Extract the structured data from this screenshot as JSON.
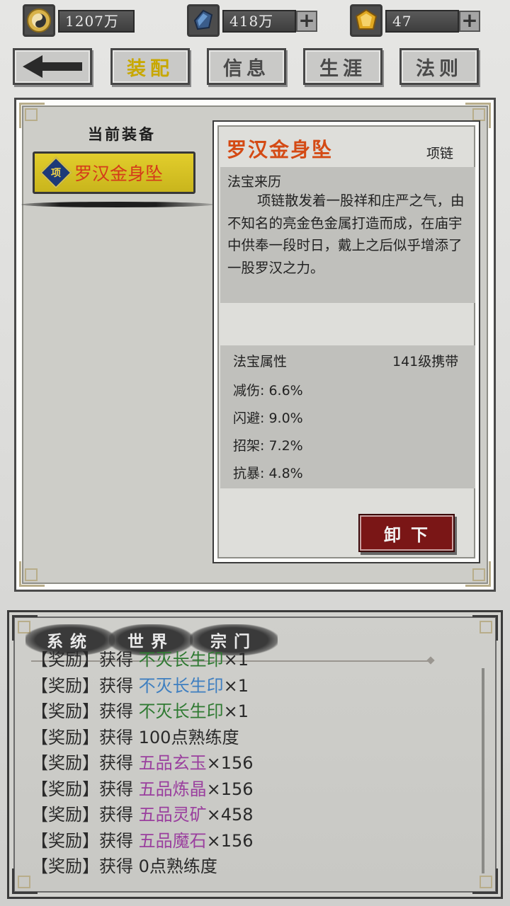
{
  "colors": {
    "accent_gold": "#c8a800",
    "title_red": "#d44a14",
    "equip_slot_yellow": "#e2cd2c",
    "unequip_button": "#7a1616",
    "item_blue": "#3f7fc0",
    "item_green": "#2f7a32",
    "item_purple": "#9a3f9e"
  },
  "resources": [
    {
      "icon": "yin-yang-coin-icon",
      "value": "1207万",
      "has_plus": false
    },
    {
      "icon": "blue-crystal-icon",
      "value": "418万",
      "has_plus": true
    },
    {
      "icon": "gold-gem-icon",
      "value": "47",
      "has_plus": true
    }
  ],
  "back_button": {
    "icon": "back-arrow-icon"
  },
  "tabs": [
    {
      "label": "装配",
      "active": true
    },
    {
      "label": "信息",
      "active": false
    },
    {
      "label": "生涯",
      "active": false
    },
    {
      "label": "法则",
      "active": false
    }
  ],
  "equipment": {
    "section_title": "当前装备",
    "slot_badge": "项",
    "slot_item": "罗汉金身坠"
  },
  "detail": {
    "item_name": "罗汉金身坠",
    "item_type": "项链",
    "lore_label": "法宝来历",
    "lore_text": "项链散发着一股祥和庄严之气，由不知名的亮金色金属打造而成，在庙宇中供奉一段时日，戴上之后似乎增添了一股罗汉之力。",
    "attr_label": "法宝属性",
    "carry_level": "141级携带",
    "attributes": [
      {
        "name": "减伤",
        "value": "6.6%"
      },
      {
        "name": "闪避",
        "value": "9.0%"
      },
      {
        "name": "招架",
        "value": "7.2%"
      },
      {
        "name": "抗暴",
        "value": "4.8%"
      }
    ],
    "unequip_label": "卸下"
  },
  "chat": {
    "tabs": [
      "系统",
      "世界",
      "宗门"
    ],
    "messages": [
      {
        "tag": "【奖励】",
        "verb": "获得 ",
        "item": "不灭长生印",
        "suffix": "×1",
        "color": "#2f7a32"
      },
      {
        "tag": "【奖励】",
        "verb": "获得 ",
        "item": "不灭长生印",
        "suffix": "×1",
        "color": "#3f7fc0"
      },
      {
        "tag": "【奖励】",
        "verb": "获得 ",
        "item": "不灭长生印",
        "suffix": "×1",
        "color": "#2f7a32"
      },
      {
        "tag": "【奖励】",
        "verb": "获得 ",
        "item": "",
        "suffix": "100点熟练度",
        "color": "#2a2a2a"
      },
      {
        "tag": "【奖励】",
        "verb": "获得 ",
        "item": "五品玄玉",
        "suffix": "×156",
        "color": "#9a3f9e"
      },
      {
        "tag": "【奖励】",
        "verb": "获得 ",
        "item": "五品炼晶",
        "suffix": "×156",
        "color": "#9a3f9e"
      },
      {
        "tag": "【奖励】",
        "verb": "获得 ",
        "item": "五品灵矿",
        "suffix": "×458",
        "color": "#9a3f9e"
      },
      {
        "tag": "【奖励】",
        "verb": "获得 ",
        "item": "五品魔石",
        "suffix": "×156",
        "color": "#9a3f9e"
      },
      {
        "tag": "【奖励】",
        "verb": "获得 ",
        "item": "",
        "suffix": "0点熟练度",
        "color": "#2a2a2a"
      }
    ]
  }
}
